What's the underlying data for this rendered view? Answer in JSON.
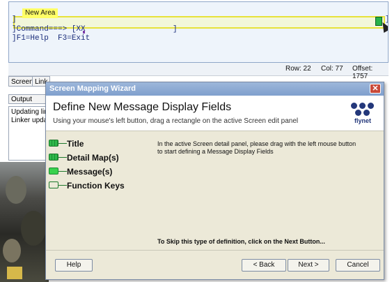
{
  "editor": {
    "new_area_tag": "New Area",
    "line1": "]",
    "line1_right": "]",
    "line2": "]Command===> [XX                   ]",
    "line3": "]F1=Help  F3=Exit"
  },
  "status": {
    "row": "Row: 22",
    "col": "Col: 77",
    "offset": "Offset: 1757"
  },
  "tabs": [
    "Screen",
    "Link"
  ],
  "output_label": "Output",
  "log_lines": [
    "Updating link",
    "Linker updat"
  ],
  "dialog": {
    "title": "Screen Mapping Wizard",
    "close_glyph": "✕",
    "heading": "Define New Message Display Fields",
    "subtitle": "Using your mouse's left button, drag a rectangle on the active Screen edit panel",
    "logo_text": "flynet",
    "steps": [
      {
        "label": "Title",
        "state": "hatched"
      },
      {
        "label": "Detail Map(s)",
        "state": "hatched"
      },
      {
        "label": "Message(s)",
        "state": "filled"
      },
      {
        "label": "Function Keys",
        "state": "empty"
      }
    ],
    "instruction": "In the active Screen detail panel, please drag with the left mouse button to start defining a Message Display Fields",
    "skip_text": "To Skip this type of definition, click on the Next Button...",
    "buttons": {
      "help": "Help",
      "back": "< Back",
      "next": "Next >",
      "cancel": "Cancel"
    }
  }
}
